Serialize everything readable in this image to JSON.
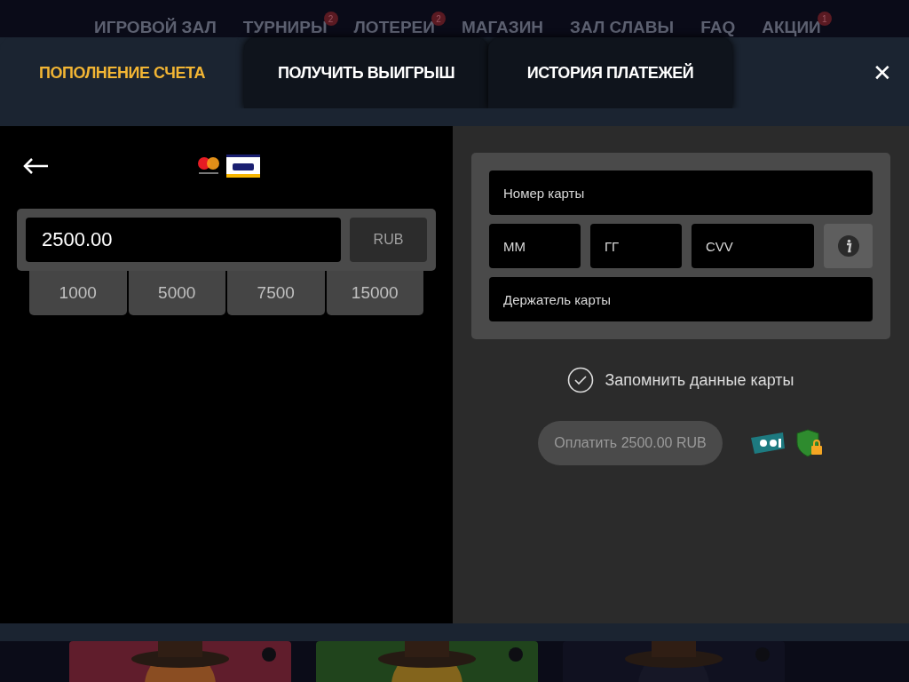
{
  "background_nav": [
    {
      "label": "ИГРОВОЙ ЗАЛ"
    },
    {
      "label": "ТУРНИРЫ",
      "badge": "2"
    },
    {
      "label": "ЛОТЕРЕИ",
      "badge": "2"
    },
    {
      "label": "МАГАЗИН"
    },
    {
      "label": "ЗАЛ СЛАВЫ"
    },
    {
      "label": "FAQ"
    },
    {
      "label": "АКЦИИ",
      "badge": "1"
    }
  ],
  "tabs": [
    {
      "label": "ПОПОЛНЕНИЕ СЧЕТА",
      "selected": true
    },
    {
      "label": "ПОЛУЧИТЬ ВЫИГРЫШ",
      "selected": false
    },
    {
      "label": "ИСТОРИЯ ПЛАТЕЖЕЙ",
      "selected": false
    }
  ],
  "close": "✕",
  "amount": {
    "value": "2500.00",
    "currency": "RUB"
  },
  "presets": [
    "1000",
    "5000",
    "7500",
    "15000"
  ],
  "card_form": {
    "number": {
      "placeholder": "Номер карты"
    },
    "month": {
      "placeholder": "ММ"
    },
    "year": {
      "placeholder": "ГГ"
    },
    "cvv": {
      "placeholder": "CVV"
    },
    "holder": {
      "placeholder": "Держатель карты"
    }
  },
  "remember": {
    "label": "Запомнить данные карты",
    "checked": true
  },
  "pay_button": {
    "label": "Оплатить 2500.00 RUB",
    "disabled": true
  }
}
